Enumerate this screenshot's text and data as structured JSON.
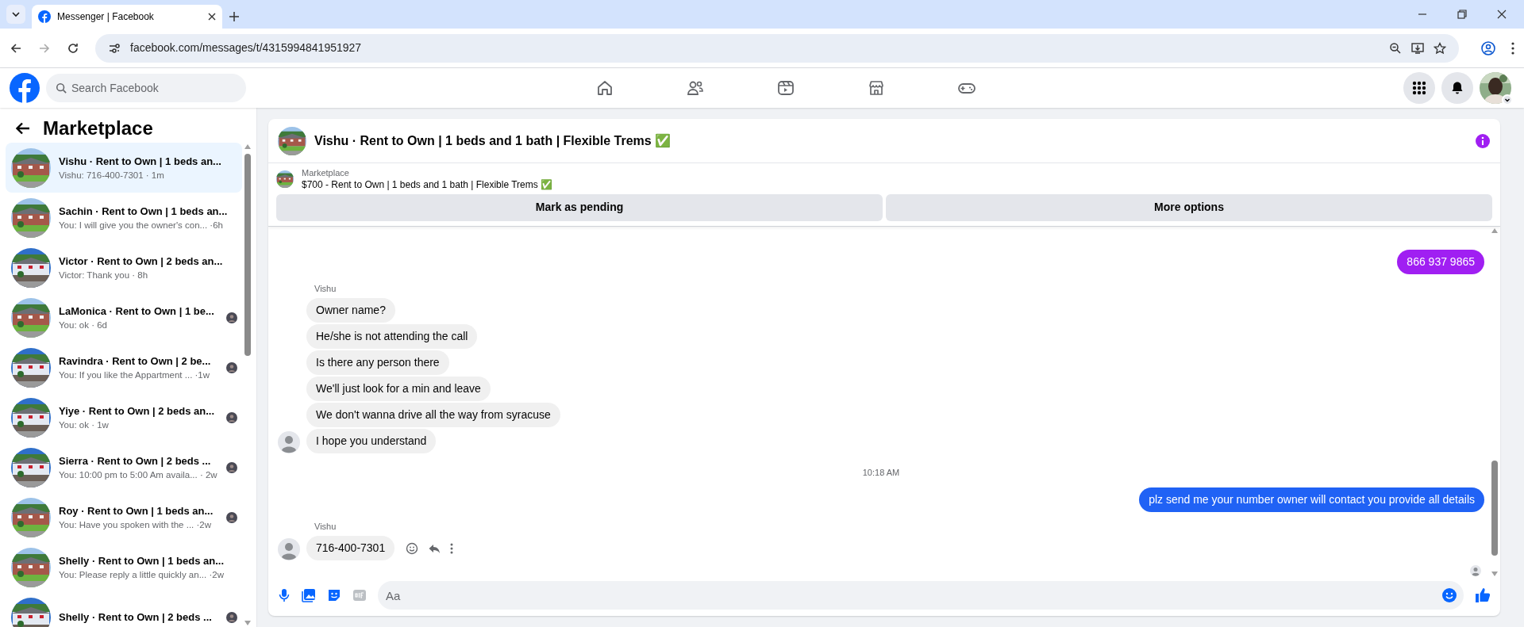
{
  "browser": {
    "tab_title": "Messenger | Facebook",
    "url": "facebook.com/messages/t/4315994841951927"
  },
  "header": {
    "search": {
      "placeholder": "Search Facebook"
    }
  },
  "sidebar": {
    "title": "Marketplace",
    "items": [
      {
        "title": "Vishu · Rent to Own | 1 beds an...",
        "preview": "Vishu: 716-400-7301 · 1m",
        "selected": true,
        "seen": false
      },
      {
        "title": "Sachin · Rent to Own | 1 beds an...",
        "preview": "You: I will give you the owner's con... ·6h",
        "selected": false,
        "seen": false
      },
      {
        "title": "Victor · Rent to Own | 2 beds an...",
        "preview": "Victor: Thank you · 8h",
        "selected": false,
        "seen": false
      },
      {
        "title": "LaMonica · Rent to Own | 1 be...",
        "preview": "You: ok · 6d",
        "selected": false,
        "seen": true
      },
      {
        "title": "Ravindra · Rent to Own | 2 be...",
        "preview": "You: If you like the Appartment ... ·1w",
        "selected": false,
        "seen": true
      },
      {
        "title": "Yiye · Rent to Own | 2 beds an...",
        "preview": "You: ok · 1w",
        "selected": false,
        "seen": true
      },
      {
        "title": "Sierra · Rent to Own | 2 beds ...",
        "preview": "You: 10:00 pm to 5:00 Am availa... · 2w",
        "selected": false,
        "seen": true
      },
      {
        "title": "Roy · Rent to Own | 1 beds an...",
        "preview": "You: Have you spoken with the ... ·2w",
        "selected": false,
        "seen": true
      },
      {
        "title": "Shelly · Rent to Own | 1 beds an...",
        "preview": "You: Please reply a little quickly an... ·2w",
        "selected": false,
        "seen": false
      },
      {
        "title": "Shelly · Rent to Own | 2 beds ...",
        "selected": false,
        "seen": true
      }
    ]
  },
  "chat": {
    "title": "Vishu · Rent to Own | 1 beds and 1 bath | Flexible Trems ✅",
    "listing": {
      "label": "Marketplace",
      "title": "$700 - Rent to Own | 1 beds and 1 bath | Flexible Trems ✅"
    },
    "buttons": [
      "Mark as pending",
      "More options"
    ],
    "messages": [
      {
        "kind": "outgoing",
        "text": "866 937 9865",
        "color": "#a01ff2"
      },
      {
        "kind": "incoming",
        "sender": "Vishu",
        "texts": [
          "Owner name?",
          "He/she is not attending the call",
          "Is there any person there",
          "We'll just look for a min and leave",
          "We don't wanna drive all the way from syracuse",
          "I hope you understand"
        ],
        "actions": false
      },
      {
        "kind": "time",
        "text": "10:18 AM"
      },
      {
        "kind": "outgoing",
        "text": "plz send me your number owner will contact you provide all details",
        "color": "#2062f5"
      },
      {
        "kind": "incoming",
        "sender": "Vishu",
        "texts": [
          "716-400-7301"
        ],
        "actions": true
      }
    ],
    "seen": true,
    "composer": {
      "placeholder": "Aa"
    }
  }
}
